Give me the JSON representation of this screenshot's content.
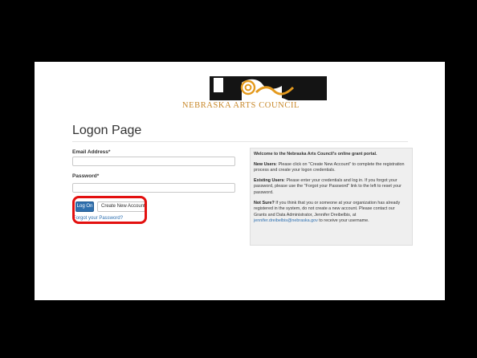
{
  "logo": {
    "name": "nebraska-arts-council-logo",
    "text": "NEBRASKA ARTS COUNCIL",
    "colors": {
      "mark": "#1a1a1a",
      "accent": "#e49a1e",
      "text": "#c8882a"
    }
  },
  "page": {
    "title": "Logon Page"
  },
  "form": {
    "email_label": "Email Address",
    "password_label": "Password",
    "required_marker": "*",
    "email_value": "",
    "password_value": "",
    "logon_label": "Log On",
    "create_account_label": "Create New Account",
    "forgot_label": "Forgot your Password?"
  },
  "info": {
    "heading": "Welcome to the Nebraska Arts Council's online grant portal.",
    "new_users_title": "New Users",
    "new_users_text": ": Please click on \"Create New Account\" to complete the registration process and create your logon credentials.",
    "existing_users_title": "Existing Users",
    "existing_users_text": ": Please enter your credentials and log in. If you forgot your password, please use the \"Forgot your Password\" link to the left to reset your password.",
    "not_sure_title": "Not Sure?",
    "not_sure_text": " If you think that you or someone at your organization has already registered in the system, do not create a new account. Please contact our Grants and Data Administrator, Jennifer Dreibelbis, at ",
    "contact_email": "jennifer.dreibelbis@nebraska.gov",
    "not_sure_suffix": " to receive your username."
  },
  "annotation": {
    "highlight_color": "#e3100f"
  }
}
